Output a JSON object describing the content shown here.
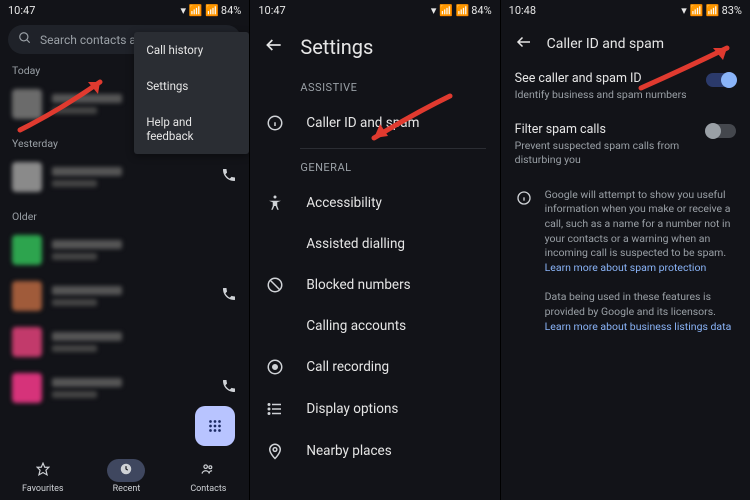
{
  "panel1": {
    "time": "10:47",
    "battery": "84%",
    "search_placeholder": "Search contacts a",
    "menu": {
      "item1": "Call history",
      "item2": "Settings",
      "item3": "Help and feedback"
    },
    "section_today": "Today",
    "section_yesterday": "Yesterday",
    "section_older": "Older",
    "nav": {
      "fav": "Favourites",
      "recent": "Recent",
      "contacts": "Contacts"
    }
  },
  "panel2": {
    "time": "10:47",
    "battery": "84%",
    "title": "Settings",
    "section_assistive": "ASSISTIVE",
    "item_caller_id": "Caller ID and spam",
    "section_general": "GENERAL",
    "item_accessibility": "Accessibility",
    "item_assisted": "Assisted dialling",
    "item_blocked": "Blocked numbers",
    "item_calling_accounts": "Calling accounts",
    "item_call_recording": "Call recording",
    "item_display": "Display options",
    "item_nearby": "Nearby places"
  },
  "panel3": {
    "time": "10:48",
    "battery": "83%",
    "title": "Caller ID and spam",
    "toggle1_title": "See caller and spam ID",
    "toggle1_sub": "Identify business and spam numbers",
    "toggle2_title": "Filter spam calls",
    "toggle2_sub": "Prevent suspected spam calls from disturbing you",
    "info1": "Google will attempt to show you useful information when you make or receive a call, such as a name for a number not in your contacts or a warning when an incoming call is suspected to be spam. ",
    "info1_link": "Learn more about spam protection",
    "info2": "Data being used in these features is provided by Google and its licensors. ",
    "info2_link": "Learn more about business listings data"
  }
}
